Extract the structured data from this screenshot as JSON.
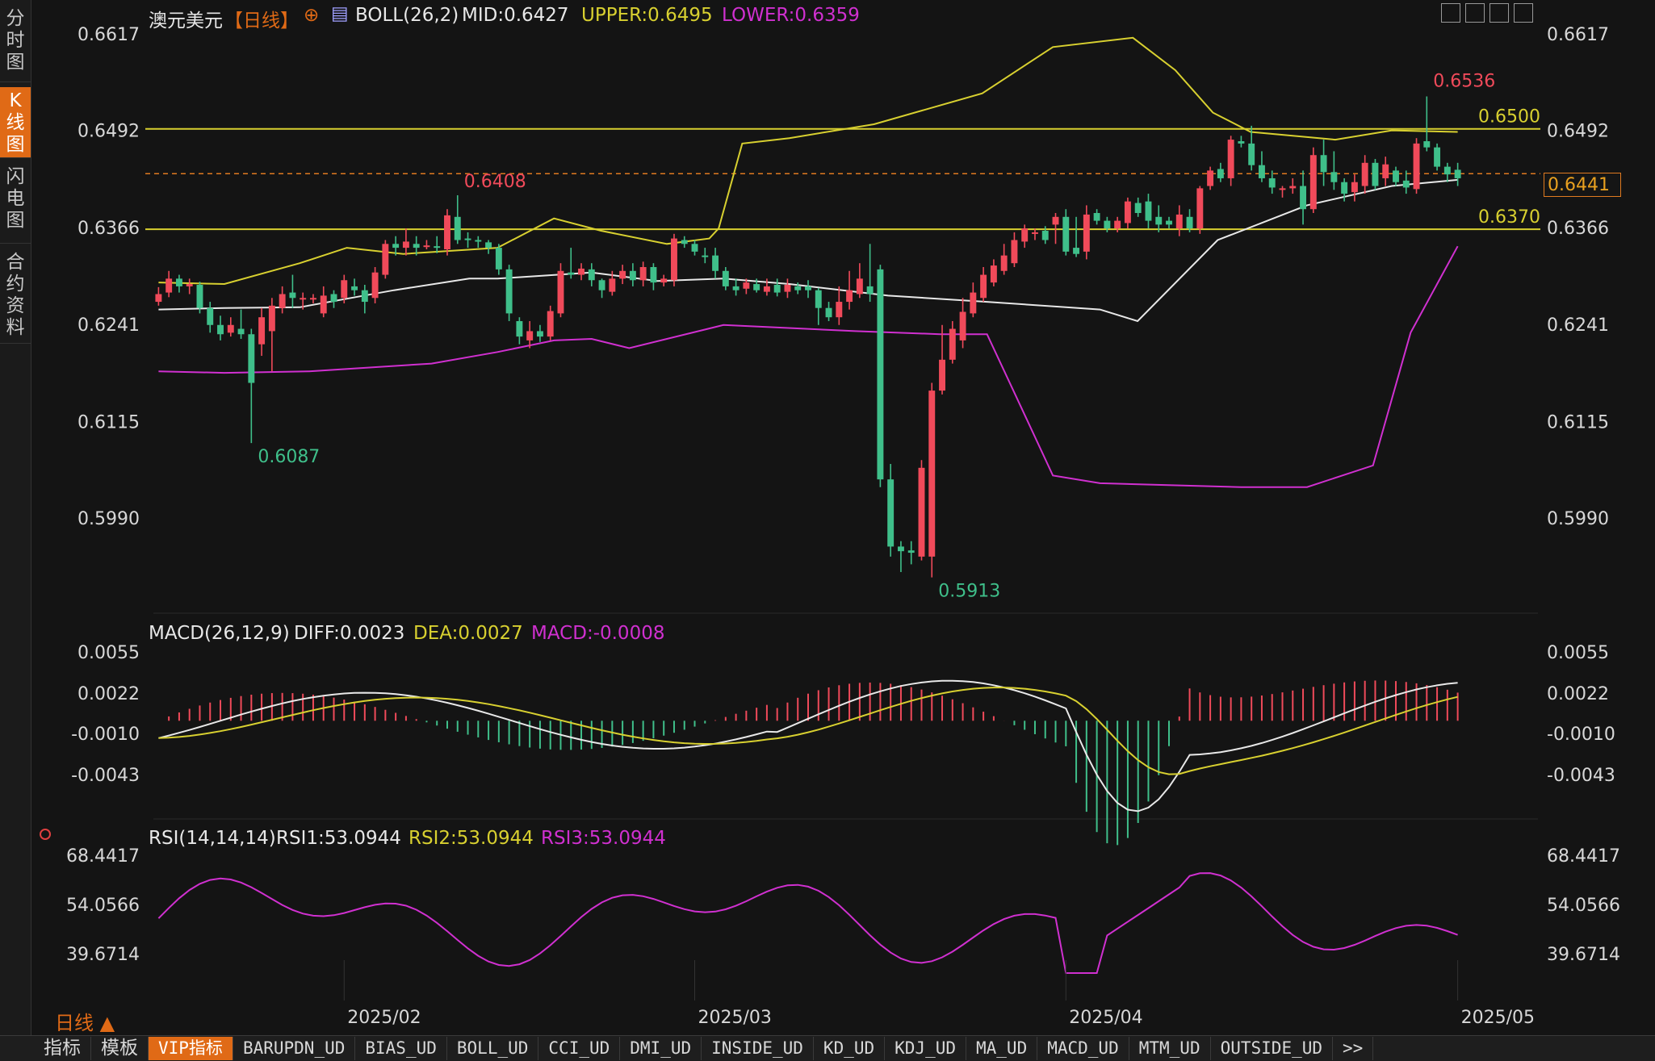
{
  "sidebar": {
    "tabs": [
      "分时图",
      "K线图",
      "闪电图",
      "合约资料"
    ],
    "active_index": 1
  },
  "header": {
    "symbol": "澳元美元",
    "period": "【日线】",
    "indicator": "BOLL(26,2)",
    "mid": "MID:0.6427",
    "upper": "UPPER:0.6495",
    "lower": "LOWER:0.6359"
  },
  "macd_header": {
    "name": "MACD(26,12,9)",
    "diff": "DIFF:0.0023",
    "dea": "DEA:0.0027",
    "macd": "MACD:-0.0008"
  },
  "rsi_header": {
    "name": "RSI(14,14,14)",
    "rsi1": "RSI1:53.0944",
    "rsi2": "RSI2:53.0944",
    "rsi3": "RSI3:53.0944"
  },
  "price_axis": [
    "0.6617",
    "0.6492",
    "0.6366",
    "0.6241",
    "0.6115",
    "0.5990"
  ],
  "macd_axis": [
    "0.0055",
    "0.0022",
    "-0.0010",
    "-0.0043"
  ],
  "rsi_axis": [
    "68.4417",
    "54.0566",
    "39.6714"
  ],
  "date_labels": [
    "2025/02",
    "2025/03",
    "2025/04",
    "2025/05"
  ],
  "annotations": {
    "high_all": "0.6536",
    "low_all": "0.5913",
    "high_feb": "0.6408",
    "low_jan": "0.6087",
    "level_upper": "0.6500",
    "level_lower": "0.6370"
  },
  "current_price": "0.6441",
  "period_label": "日线 ▲",
  "bottom_bar": [
    "指标",
    "模板",
    "VIP指标",
    "BARUPDN_UD",
    "BIAS_UD",
    "BOLL_UD",
    "CCI_UD",
    "DMI_UD",
    "INSIDE_UD",
    "KD_UD",
    "KDJ_UD",
    "MA_UD",
    "MACD_UD",
    "MTM_UD",
    "OUTSIDE_UD",
    ">>"
  ],
  "colors": {
    "up": "#f04a5a",
    "down": "#3fbf8a",
    "upper": "#d8d030",
    "lower": "#d030d0",
    "mid": "#e8e8e8",
    "accent": "#e06a16"
  },
  "chart_data": {
    "type": "candlestick",
    "ylim": [
      0.59,
      0.664
    ],
    "candles": [
      [
        0.627,
        0.628,
        0.6265,
        0.6289
      ],
      [
        0.6282,
        0.63,
        0.6276,
        0.631
      ],
      [
        0.63,
        0.629,
        0.6282,
        0.6305
      ],
      [
        0.629,
        0.6293,
        0.628,
        0.63
      ],
      [
        0.6292,
        0.6262,
        0.6255,
        0.6296
      ],
      [
        0.6262,
        0.624,
        0.623,
        0.627
      ],
      [
        0.624,
        0.6228,
        0.622,
        0.6252
      ],
      [
        0.623,
        0.624,
        0.6225,
        0.625
      ],
      [
        0.6235,
        0.6228,
        0.6222,
        0.626
      ],
      [
        0.6228,
        0.6165,
        0.6087,
        0.6235
      ],
      [
        0.6215,
        0.625,
        0.62,
        0.6262
      ],
      [
        0.6232,
        0.6265,
        0.618,
        0.6275
      ],
      [
        0.6262,
        0.628,
        0.6255,
        0.629
      ],
      [
        0.6282,
        0.6275,
        0.6262,
        0.6305
      ],
      [
        0.6275,
        0.6275,
        0.626,
        0.6282
      ],
      [
        0.6275,
        0.6275,
        0.6268,
        0.628
      ],
      [
        0.6255,
        0.6278,
        0.625,
        0.629
      ],
      [
        0.628,
        0.627,
        0.6262,
        0.6285
      ],
      [
        0.6275,
        0.6298,
        0.6268,
        0.6305
      ],
      [
        0.629,
        0.6285,
        0.6278,
        0.63
      ],
      [
        0.6285,
        0.627,
        0.6255,
        0.6292
      ],
      [
        0.6275,
        0.6308,
        0.6268,
        0.6315
      ],
      [
        0.6305,
        0.6345,
        0.63,
        0.635
      ],
      [
        0.6345,
        0.634,
        0.633,
        0.6355
      ],
      [
        0.634,
        0.6348,
        0.633,
        0.6365
      ],
      [
        0.6345,
        0.634,
        0.633,
        0.6355
      ],
      [
        0.6343,
        0.6343,
        0.6338,
        0.635
      ],
      [
        0.6342,
        0.634,
        0.6333,
        0.6355
      ],
      [
        0.6338,
        0.6382,
        0.633,
        0.639
      ],
      [
        0.638,
        0.635,
        0.6345,
        0.6408
      ],
      [
        0.6352,
        0.635,
        0.634,
        0.636
      ],
      [
        0.635,
        0.6348,
        0.634,
        0.6355
      ],
      [
        0.6347,
        0.634,
        0.6332,
        0.635
      ],
      [
        0.634,
        0.6312,
        0.6305,
        0.6345
      ],
      [
        0.6312,
        0.6255,
        0.6245,
        0.6318
      ],
      [
        0.6245,
        0.6225,
        0.6215,
        0.625
      ],
      [
        0.622,
        0.6232,
        0.621,
        0.6245
      ],
      [
        0.6232,
        0.6225,
        0.6218,
        0.624
      ],
      [
        0.6225,
        0.6258,
        0.622,
        0.6265
      ],
      [
        0.6255,
        0.631,
        0.625,
        0.632
      ],
      [
        0.6308,
        0.6305,
        0.63,
        0.634
      ],
      [
        0.6305,
        0.6313,
        0.6298,
        0.632
      ],
      [
        0.6312,
        0.6298,
        0.629,
        0.632
      ],
      [
        0.6298,
        0.6285,
        0.6275,
        0.63
      ],
      [
        0.6283,
        0.63,
        0.6278,
        0.631
      ],
      [
        0.63,
        0.631,
        0.6293,
        0.6318
      ],
      [
        0.631,
        0.6298,
        0.629,
        0.632
      ],
      [
        0.6298,
        0.6315,
        0.629,
        0.6322
      ],
      [
        0.6315,
        0.6295,
        0.6285,
        0.632
      ],
      [
        0.6295,
        0.63,
        0.629,
        0.6305
      ],
      [
        0.6298,
        0.6352,
        0.629,
        0.6358
      ],
      [
        0.635,
        0.6345,
        0.634,
        0.6355
      ],
      [
        0.6345,
        0.6335,
        0.633,
        0.635
      ],
      [
        0.633,
        0.6328,
        0.632,
        0.634
      ],
      [
        0.633,
        0.631,
        0.63,
        0.634
      ],
      [
        0.631,
        0.629,
        0.6285,
        0.6315
      ],
      [
        0.629,
        0.6285,
        0.6278,
        0.63
      ],
      [
        0.6287,
        0.6295,
        0.628,
        0.63
      ],
      [
        0.6293,
        0.6285,
        0.6282,
        0.63
      ],
      [
        0.6283,
        0.629,
        0.6278,
        0.63
      ],
      [
        0.6292,
        0.6282,
        0.6277,
        0.63
      ],
      [
        0.6283,
        0.6292,
        0.6275,
        0.63
      ],
      [
        0.629,
        0.6285,
        0.628,
        0.6295
      ],
      [
        0.629,
        0.6285,
        0.6275,
        0.6298
      ],
      [
        0.6285,
        0.6262,
        0.624,
        0.6288
      ],
      [
        0.6262,
        0.625,
        0.6245,
        0.627
      ],
      [
        0.625,
        0.627,
        0.624,
        0.629
      ],
      [
        0.627,
        0.6285,
        0.626,
        0.631
      ],
      [
        0.628,
        0.63,
        0.6275,
        0.632
      ],
      [
        0.629,
        0.628,
        0.627,
        0.6345
      ],
      [
        0.6312,
        0.604,
        0.603,
        0.6318
      ],
      [
        0.604,
        0.5953,
        0.594,
        0.606
      ],
      [
        0.5953,
        0.5947,
        0.592,
        0.596
      ],
      [
        0.5948,
        0.5945,
        0.593,
        0.596
      ],
      [
        0.594,
        0.6055,
        0.5935,
        0.6065
      ],
      [
        0.594,
        0.6155,
        0.5913,
        0.6165
      ],
      [
        0.6155,
        0.6195,
        0.615,
        0.624
      ],
      [
        0.6195,
        0.6235,
        0.619,
        0.6245
      ],
      [
        0.622,
        0.6257,
        0.621,
        0.6275
      ],
      [
        0.6255,
        0.6282,
        0.625,
        0.6295
      ],
      [
        0.6275,
        0.6305,
        0.627,
        0.6315
      ],
      [
        0.6295,
        0.6317,
        0.629,
        0.6325
      ],
      [
        0.631,
        0.633,
        0.6305,
        0.6345
      ],
      [
        0.632,
        0.635,
        0.6315,
        0.636
      ],
      [
        0.6348,
        0.6365,
        0.634,
        0.637
      ],
      [
        0.636,
        0.636,
        0.635,
        0.6365
      ],
      [
        0.6362,
        0.635,
        0.6345,
        0.6368
      ],
      [
        0.637,
        0.638,
        0.6345,
        0.6385
      ],
      [
        0.638,
        0.6335,
        0.633,
        0.639
      ],
      [
        0.634,
        0.6332,
        0.6328,
        0.638
      ],
      [
        0.6335,
        0.6383,
        0.6325,
        0.6395
      ],
      [
        0.6385,
        0.6375,
        0.637,
        0.639
      ],
      [
        0.6375,
        0.6365,
        0.636,
        0.638
      ],
      [
        0.6365,
        0.6375,
        0.636,
        0.638
      ],
      [
        0.6372,
        0.64,
        0.6365,
        0.6405
      ],
      [
        0.6398,
        0.6385,
        0.638,
        0.6405
      ],
      [
        0.64,
        0.6375,
        0.6365,
        0.641
      ],
      [
        0.638,
        0.637,
        0.636,
        0.6395
      ],
      [
        0.6375,
        0.637,
        0.6365,
        0.638
      ],
      [
        0.6365,
        0.6383,
        0.6355,
        0.6395
      ],
      [
        0.638,
        0.6365,
        0.636,
        0.639
      ],
      [
        0.6365,
        0.6417,
        0.6358,
        0.642
      ],
      [
        0.642,
        0.644,
        0.6415,
        0.6445
      ],
      [
        0.6442,
        0.643,
        0.6425,
        0.645
      ],
      [
        0.643,
        0.648,
        0.642,
        0.6485
      ],
      [
        0.6478,
        0.6475,
        0.647,
        0.6485
      ],
      [
        0.6475,
        0.6447,
        0.644,
        0.6498
      ],
      [
        0.6447,
        0.643,
        0.6425,
        0.6465
      ],
      [
        0.643,
        0.6418,
        0.641,
        0.644
      ],
      [
        0.6415,
        0.6417,
        0.6405,
        0.642
      ],
      [
        0.6417,
        0.642,
        0.641,
        0.643
      ],
      [
        0.642,
        0.639,
        0.637,
        0.644
      ],
      [
        0.639,
        0.646,
        0.6385,
        0.647
      ],
      [
        0.646,
        0.6438,
        0.642,
        0.648
      ],
      [
        0.6438,
        0.6425,
        0.6415,
        0.6465
      ],
      [
        0.6425,
        0.641,
        0.64,
        0.643
      ],
      [
        0.6412,
        0.6425,
        0.64,
        0.6435
      ],
      [
        0.642,
        0.645,
        0.641,
        0.646
      ],
      [
        0.645,
        0.642,
        0.6415,
        0.6455
      ],
      [
        0.643,
        0.6448,
        0.642,
        0.6458
      ],
      [
        0.644,
        0.6425,
        0.642,
        0.6445
      ],
      [
        0.6427,
        0.6418,
        0.641,
        0.644
      ],
      [
        0.6416,
        0.6475,
        0.641,
        0.6482
      ],
      [
        0.6478,
        0.647,
        0.6465,
        0.6536
      ],
      [
        0.647,
        0.6445,
        0.644,
        0.6475
      ],
      [
        0.6445,
        0.6435,
        0.6425,
        0.645
      ],
      [
        0.6441,
        0.643,
        0.642,
        0.645
      ]
    ],
    "boll_upper": [
      [
        0,
        0.6295
      ],
      [
        14,
        0.6293
      ],
      [
        30,
        0.632
      ],
      [
        40,
        0.634
      ],
      [
        52,
        0.6332
      ],
      [
        72,
        0.634
      ],
      [
        84,
        0.6378
      ],
      [
        94,
        0.6362
      ],
      [
        108,
        0.6345
      ],
      [
        117,
        0.6352
      ],
      [
        119,
        0.6365
      ],
      [
        124,
        0.6475
      ],
      [
        134,
        0.6482
      ],
      [
        152,
        0.65
      ],
      [
        175,
        0.654
      ],
      [
        190,
        0.66
      ],
      [
        207,
        0.6612
      ],
      [
        216,
        0.657
      ],
      [
        224,
        0.6515
      ],
      [
        232,
        0.649
      ],
      [
        250,
        0.648
      ],
      [
        262,
        0.6492
      ],
      [
        276,
        0.649
      ]
    ],
    "boll_mid": [
      [
        0,
        0.626
      ],
      [
        14,
        0.6262
      ],
      [
        30,
        0.6263
      ],
      [
        50,
        0.6285
      ],
      [
        66,
        0.63
      ],
      [
        72,
        0.63
      ],
      [
        92,
        0.6308
      ],
      [
        106,
        0.6297
      ],
      [
        120,
        0.63
      ],
      [
        134,
        0.6293
      ],
      [
        155,
        0.6278
      ],
      [
        176,
        0.627
      ],
      [
        200,
        0.626
      ],
      [
        208,
        0.6245
      ],
      [
        225,
        0.635
      ],
      [
        244,
        0.6395
      ],
      [
        262,
        0.642
      ],
      [
        276,
        0.6428
      ]
    ],
    "boll_lower": [
      [
        0,
        0.618
      ],
      [
        14,
        0.6178
      ],
      [
        32,
        0.618
      ],
      [
        58,
        0.619
      ],
      [
        72,
        0.6205
      ],
      [
        84,
        0.622
      ],
      [
        92,
        0.6222
      ],
      [
        100,
        0.621
      ],
      [
        120,
        0.624
      ],
      [
        148,
        0.6232
      ],
      [
        166,
        0.6228
      ],
      [
        176,
        0.6228
      ],
      [
        182,
        0.615
      ],
      [
        190,
        0.6045
      ],
      [
        200,
        0.6035
      ],
      [
        230,
        0.603
      ],
      [
        244,
        0.603
      ],
      [
        258,
        0.6058
      ],
      [
        266,
        0.623
      ],
      [
        276,
        0.6342
      ]
    ],
    "macd_hist_sample": "bars below/above zero following DIFF-DEA",
    "rsi_range": [
      30,
      72
    ]
  }
}
